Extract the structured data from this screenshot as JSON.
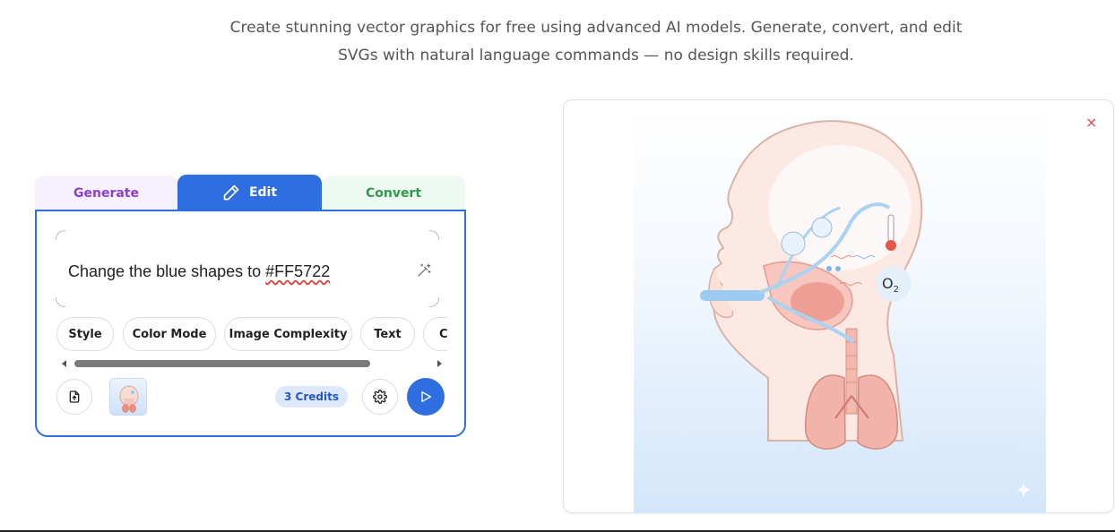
{
  "header": {
    "subtitle_line1": "Create stunning vector graphics for free using advanced AI models. Generate, convert, and edit",
    "subtitle_line2": "SVGs with natural language commands — no design skills required."
  },
  "tabs": [
    {
      "label": "Generate",
      "color": "#8a3fd1"
    },
    {
      "label": "Edit",
      "color": "#ffffff",
      "active": true
    },
    {
      "label": "Convert",
      "color": "#2f9a4c"
    }
  ],
  "editor": {
    "prompt_prefix": "Change the blue shapes to ",
    "prompt_misspelled": "#FF5722",
    "chips": [
      "Style",
      "Color Mode",
      "Image Complexity",
      "Text",
      "C"
    ],
    "credits_label": "3 Credits",
    "icons": {
      "enhance": "magic-wand-icon",
      "upload": "upload-file-icon",
      "settings": "gear-icon",
      "send": "play-send-icon"
    },
    "accent": "#2f6ee0"
  },
  "preview": {
    "close_symbol": "×",
    "image_subject": "head-respiratory-anatomy-illustration",
    "labels": {
      "o2": "O",
      "o2_sub": "2"
    }
  }
}
